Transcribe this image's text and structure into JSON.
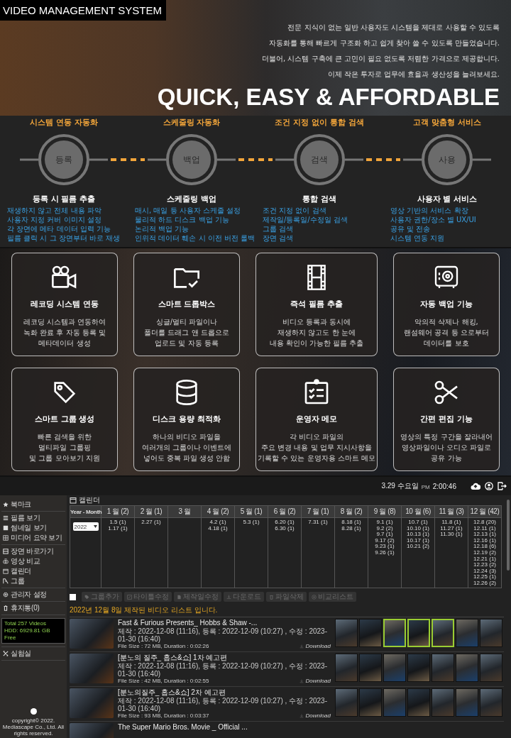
{
  "header": {
    "title": "VIDEO MANAGEMENT SYSTEM"
  },
  "intro": {
    "lines": [
      "전문 지식이 없는 일반 사용자도 시스템을 제대로 사용할 수 있도록",
      "자동화를 통해 빠르게 구조화 하고 쉽게 찾아 쓸 수 있도록 만들었습니다.",
      "더불어, 시스템 구축에 큰 고민이 필요 없도록 저렴한 가격으로 제공합니다.",
      "이제 작은 투자로 업무에 효율과 생산성을 늘려보세요."
    ],
    "headline": "QUICK, EASY & AFFORDABLE"
  },
  "steps": [
    {
      "category": "시스템 연동 자동화",
      "label": "등록",
      "title": "등록 시 필름 추출",
      "points": [
        "재생하지 않고 전체 내용 파악",
        "사용자 지정 커버 이미지 설정",
        "각 장면에 메타 데이터 입력 기능",
        "필름 클릭 시 그 장면부터 바로 재생"
      ]
    },
    {
      "category": "스케줄링 자동화",
      "label": "백업",
      "title": "스케줄링 백업",
      "points": [
        "매시, 매일 등 사용자 스케줄 설정",
        "물리적 하드 디스크 백업 기능",
        "논리적 백업 기능",
        "인위적 데이터 훼손 시 이전 버전 롤백"
      ]
    },
    {
      "category": "조건 지정 없이 통합 검색",
      "label": "검색",
      "title": "통합 검색",
      "points": [
        "조건 지정 없이 검색",
        "제작일/등록일/수정일 검색",
        "그룹 검색",
        "장면 검색"
      ]
    },
    {
      "category": "고객 맞춤형 서비스",
      "label": "사용",
      "title": "사용자 별 서비스",
      "points": [
        "영상 기반의 서비스 확장",
        "사용자 권한/장소 별 UX/UI",
        "공유 및 전송",
        "시스템 연동 지원"
      ]
    }
  ],
  "features": [
    {
      "kind": "camera",
      "title": "레코딩 시스템 연동",
      "lines": [
        "레코딩 시스템과 연동하여",
        "녹화 완료 후 자동 등록 및",
        "메타데이터 생성"
      ]
    },
    {
      "kind": "folder",
      "title": "스마트 드롭박스",
      "lines": [
        "싱글/멀티 파일이나",
        "폴더를 드래그 앤 드롭으로",
        "업로드 및 자동 등록"
      ]
    },
    {
      "kind": "film",
      "title": "즉석 필름 추출",
      "lines": [
        "비디오 등록과 동시에",
        "재생하지 않고도 한 눈에",
        "내용 확인이 가능한 필름 추출"
      ]
    },
    {
      "kind": "safe",
      "title": "자동 백업 기능",
      "lines": [
        "악의적 삭제나 해킹,",
        "랜섬웨어 공격 등 으로부터",
        "데이터를 보호"
      ]
    },
    {
      "kind": "tag",
      "title": "스마트 그룹 생성",
      "lines": [
        "빠른 검색을 위한",
        "멀티파일 그룹핑",
        "및 그룹 모아보기 지원"
      ]
    },
    {
      "kind": "database",
      "title": "디스크 용량 최적화",
      "lines": [
        "하나의 비디오 파일을",
        "여러개의 그룹이나 이벤트에",
        "넣어도 중복 파일 생성 안함"
      ]
    },
    {
      "kind": "checklist",
      "title": "운영자 메모",
      "lines": [
        "각 비디오 파일의",
        "주요 변경 내용 및 업무 지시사항을",
        "기록할 수 있는 운영자용 스마트 메모"
      ]
    },
    {
      "kind": "scissors",
      "title": "간편 편집 기능",
      "lines": [
        "영상의 특정 구간을 잘라내어",
        "영상파일이나 오디오 파일로",
        "공유 가능"
      ]
    }
  ],
  "app": {
    "clock": {
      "date": "3.29 수요일",
      "meridiem": "PM",
      "time": "2:00:46"
    },
    "sidebar": {
      "sections": [
        [
          {
            "kind": "star",
            "label": "북마크"
          }
        ],
        [
          {
            "kind": "list",
            "label": "필름 보기"
          },
          {
            "kind": "square",
            "label": "썸네일 보기"
          },
          {
            "kind": "grid",
            "label": "미디어 요약 보기"
          }
        ],
        [
          {
            "kind": "film",
            "label": "장면 바로가기"
          },
          {
            "kind": "compare",
            "label": "영상 비교"
          },
          {
            "kind": "calendar",
            "label": "캘린더"
          },
          {
            "kind": "group",
            "label": "그룹"
          }
        ],
        [
          {
            "kind": "gear",
            "label": "관리자 설정"
          }
        ],
        [
          {
            "kind": "trash",
            "label": "휴지통(0)"
          }
        ]
      ],
      "status": [
        "Total 257 Videos",
        "HDD: 6929.81 GB Free"
      ],
      "lab": {
        "kind": "lab",
        "label": "실험실"
      },
      "copyright": "copyright© 2022. Mediascape Co., Ltd. All rights reserved."
    },
    "page_title": "캘린더",
    "calendar": {
      "corner": "Year - Month",
      "year": "2022",
      "months": [
        {
          "label": "1 월 (2)",
          "days": [
            "1.5 (1)",
            "1.17 (1)"
          ]
        },
        {
          "label": "2 월 (1)",
          "days": [
            "2.27 (1)"
          ]
        },
        {
          "label": "3 월"
        },
        {
          "label": "4 월 (2)",
          "days": [
            "4.2 (1)",
            "4.18 (1)"
          ]
        },
        {
          "label": "5 월 (1)",
          "days": [
            "5.3 (1)"
          ]
        },
        {
          "label": "6 월 (2)",
          "days": [
            "6.20 (1)",
            "6.30 (1)"
          ]
        },
        {
          "label": "7 월 (1)",
          "days": [
            "7.31 (1)"
          ]
        },
        {
          "label": "8 월 (2)",
          "days": [
            "8.18 (1)",
            "8.28 (1)"
          ]
        },
        {
          "label": "9 월 (8)",
          "days": [
            "9.1 (1)",
            "9.2 (2)",
            "9.7 (1)",
            "9.17 (2)",
            "9.23 (1)",
            "9.26 (1)"
          ]
        },
        {
          "label": "10 월 (6)",
          "days": [
            "10.7 (1)",
            "10.10 (1)",
            "10.13 (1)",
            "10.17 (1)",
            "10.21 (2)"
          ]
        },
        {
          "label": "11 월 (3)",
          "days": [
            "11.8 (1)",
            "11.27 (1)",
            "11.30 (1)"
          ]
        },
        {
          "label": "12 월 (42)",
          "days": [
            "12.8 (20)",
            "12.11 (1)",
            "12.13 (1)",
            "12.16 (1)",
            "12.18 (6)",
            "12.19 (2)",
            "12.21 (1)",
            "12.23 (2)",
            "12.24 (3)",
            "12.25 (1)",
            "12.26 (2)"
          ]
        }
      ]
    },
    "toolbar": {
      "select_all": {
        "checked": false
      },
      "buttons": [
        {
          "kind": "tag",
          "label": "그룹추가",
          "disabled": true
        },
        {
          "kind": "edit",
          "label": "타이틀수정",
          "disabled": true
        },
        {
          "kind": "date",
          "label": "제작일수정",
          "disabled": true
        },
        {
          "kind": "download",
          "label": "다운로드",
          "disabled": true
        },
        {
          "kind": "trash",
          "label": "파일삭제",
          "disabled": true
        },
        {
          "kind": "compare",
          "label": "비교리스트",
          "disabled": true
        }
      ]
    },
    "caption": "2022년 12월 8일 제작된 비디오 리스트 입니다.",
    "videos": [
      {
        "title": "Fast & Furious Presents_ Hobbs & Shaw -...",
        "meta": "제작 : 2022-12-08 (11:16), 등록 : 2022-12-09 (10:27) , 수정 : 2023-01-30 (16:40)",
        "file": "File Size : 72 MB, Duration : 0:02:26",
        "download": "Download",
        "frames": [
          {
            "selected": false
          },
          {
            "selected": false
          },
          {
            "selected": true
          },
          {
            "selected": true
          },
          {
            "selected": true
          },
          {
            "selected": false
          },
          {
            "selected": false
          }
        ]
      },
      {
        "title": "[분노의 질주_ 홉스&쇼] 1차 예고편",
        "meta": "제작 : 2022-12-08 (11:16), 등록 : 2022-12-09 (10:27) , 수정 : 2023-01-30 (16:40)",
        "file": "File Size : 42 MB, Duration : 0:02:55",
        "download": "Download",
        "frames": [
          {
            "selected": false
          },
          {
            "selected": false
          },
          {
            "selected": false
          },
          {
            "selected": false
          },
          {
            "selected": false
          },
          {
            "selected": false
          },
          {
            "selected": false
          }
        ]
      },
      {
        "title": "[분노의질주_ 홉스&쇼] 2차 예고편",
        "meta": "제작 : 2022-12-08 (11:16), 등록 : 2022-12-09 (10:27) , 수정 : 2023-01-30 (16:40)",
        "file": "File Size : 93 MB, Duration : 0:03:37",
        "download": "Download",
        "frames": [
          {
            "selected": false
          },
          {
            "selected": false
          },
          {
            "selected": false
          },
          {
            "selected": false
          },
          {
            "selected": false
          },
          {
            "selected": false
          },
          {
            "selected": false
          }
        ]
      },
      {
        "title": "The Super Mario Bros. Movie _ Official ..."
      }
    ]
  }
}
